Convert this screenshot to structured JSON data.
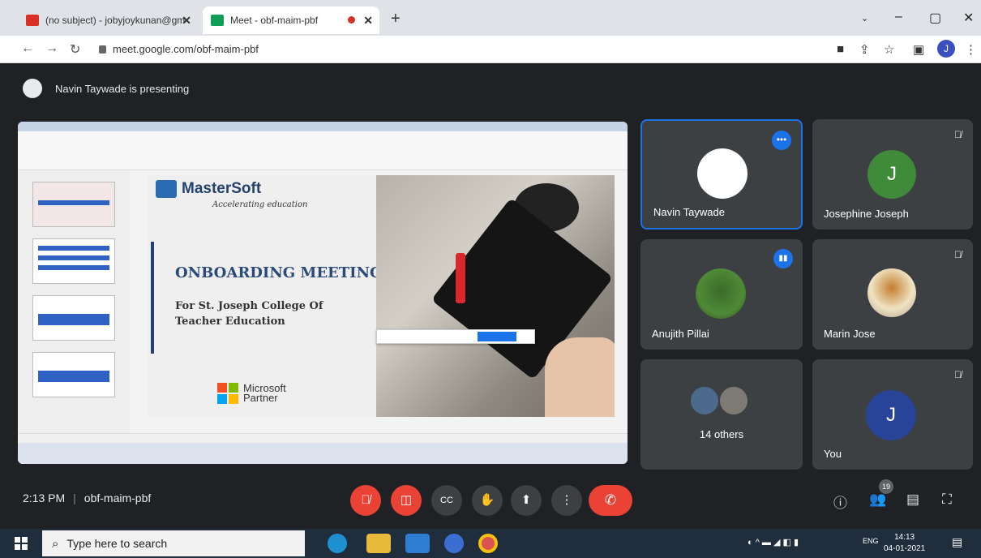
{
  "browser": {
    "tabs": [
      {
        "label": "(no subject) - jobyjoykunan@gm",
        "icon": "gmail-icon"
      },
      {
        "label": "Meet - obf-maim-pbf",
        "icon": "meet-icon",
        "recording": true
      }
    ],
    "url": "meet.google.com/obf-maim-pbf",
    "profile_initial": "J"
  },
  "meet": {
    "presenter_banner": "Navin Taywade is presenting",
    "slide": {
      "brand": "MasterSoft",
      "tagline": "Accelerating education",
      "title": "ONBOARDING MEETING",
      "subtitle": "For St. Joseph College Of Teacher Education",
      "partner_line1": "Microsoft",
      "partner_line2": "Partner"
    },
    "participants": [
      {
        "name": "Navin Taywade",
        "active": true
      },
      {
        "name": "Josephine Joseph",
        "initial": "J",
        "muted": true
      },
      {
        "name": "Anujith Pillai",
        "speaking": true
      },
      {
        "name": "Marin Jose",
        "muted": true
      },
      {
        "name": "14 others"
      },
      {
        "name": "You",
        "initial": "J",
        "muted": true
      }
    ],
    "time": "2:13 PM",
    "meeting_code": "obf-maim-pbf",
    "people_count": "19"
  },
  "taskbar": {
    "search_placeholder": "Type here to search",
    "clock_time": "14:13",
    "clock_date": "04-01-2021",
    "lang": "ENG"
  }
}
